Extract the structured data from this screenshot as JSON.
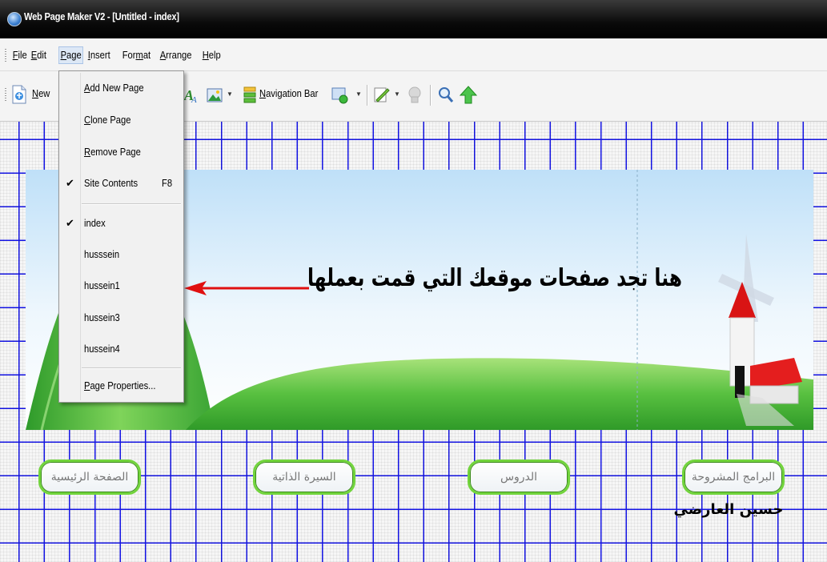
{
  "window": {
    "title": "Web Page Maker V2 - [Untitled - index]"
  },
  "menubar": {
    "items": [
      {
        "key": "F",
        "rest": "ile"
      },
      {
        "key": "E",
        "rest": "dit"
      },
      {
        "key": "P",
        "rest": "age"
      },
      {
        "key": "I",
        "rest": "nsert"
      },
      {
        "pre": "For",
        "key": "m",
        "rest": "at"
      },
      {
        "key": "A",
        "rest": "rrange"
      },
      {
        "key": "H",
        "rest": "elp"
      }
    ],
    "labels": {
      "file_pre": "",
      "file_key": "F",
      "file_rest": "ile",
      "edit_pre": "",
      "edit_key": "E",
      "edit_rest": "dit",
      "page_pre": "",
      "page_key": "P",
      "page_rest": "age",
      "insert_pre": "",
      "insert_key": "I",
      "insert_rest": "nsert",
      "format_pre": "For",
      "format_key": "m",
      "format_rest": "at",
      "arrange_pre": "",
      "arrange_key": "A",
      "arrange_rest": "rrange",
      "help_pre": "",
      "help_key": "H",
      "help_rest": "elp"
    }
  },
  "toolbar": {
    "new_key": "N",
    "new_rest": "ew",
    "navbar_key": "N",
    "navbar_rest": "avigation Bar",
    "icons": [
      "new-page-icon",
      "text-icon",
      "image-icon",
      "navigation-bar-icon",
      "form-icon",
      "edit-icon",
      "preview-icon",
      "zoom-icon",
      "publish-icon"
    ]
  },
  "page_menu": {
    "add_pre": "",
    "add_key": "A",
    "add_rest": "dd New Page",
    "clone_pre": "",
    "clone_key": "C",
    "clone_rest": "lone Page",
    "remove_pre": "",
    "remove_key": "R",
    "remove_rest": "emove Page",
    "site_contents": "Site Contents",
    "site_contents_shortcut": "F8",
    "site_contents_checked": true,
    "pages": [
      "index",
      "husssein",
      "hussein1",
      "hussein3",
      "hussein4"
    ],
    "checked_page": "index",
    "properties_pre": "",
    "properties_key": "P",
    "properties_rest": "age Properties..."
  },
  "canvas": {
    "banner_caption": "هنا تجد صفحات موقعك التي قمت بعملها",
    "nav_buttons": [
      "الصفحة الرئيسية",
      "السيرة الذاتية",
      "الدروس",
      "البرامج المشروحة"
    ],
    "author": "حسين العارضي",
    "grid_color": "#1414e6",
    "button_border_color": "#72d43d"
  }
}
